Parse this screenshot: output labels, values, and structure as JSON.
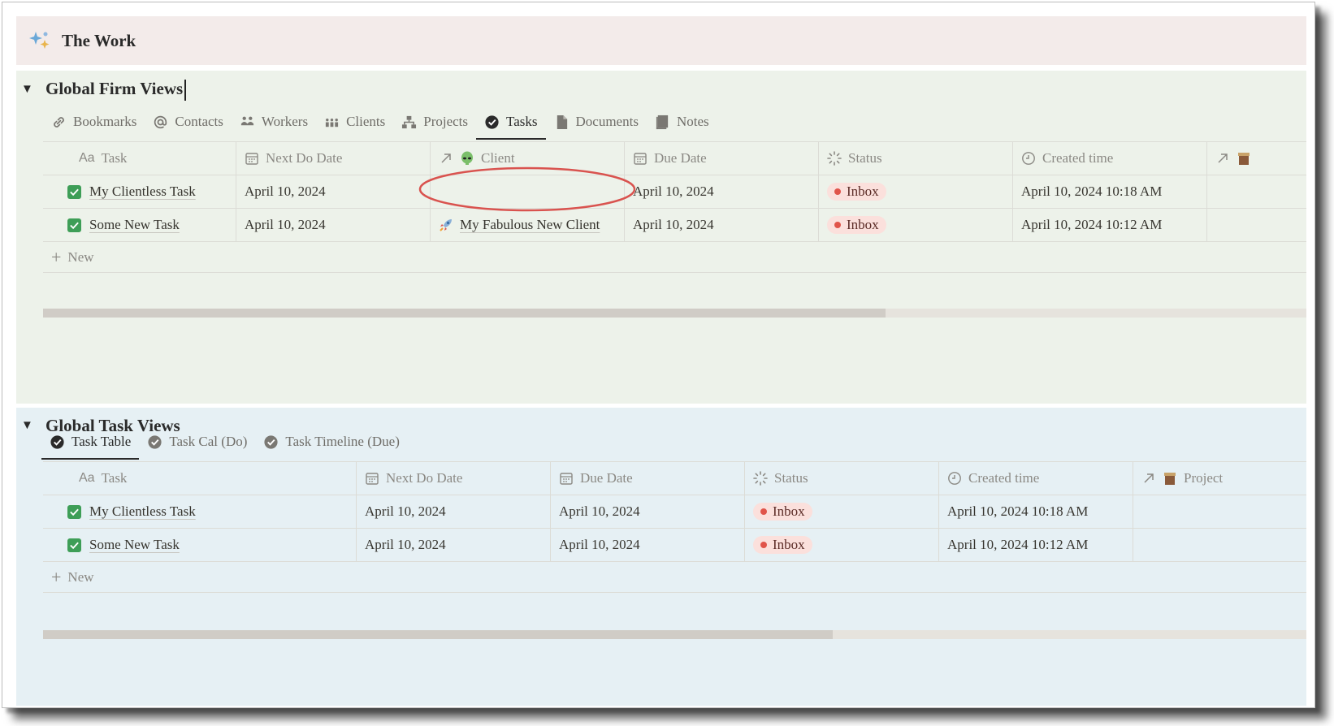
{
  "page": {
    "title": "The Work"
  },
  "firm_section": {
    "heading": "Global Firm Views",
    "tabs": [
      {
        "label": "Bookmarks",
        "icon": "link-icon",
        "active": false
      },
      {
        "label": "Contacts",
        "icon": "at-icon",
        "active": false
      },
      {
        "label": "Workers",
        "icon": "people-icon",
        "active": false
      },
      {
        "label": "Clients",
        "icon": "group-icon",
        "active": false
      },
      {
        "label": "Projects",
        "icon": "hierarchy-icon",
        "active": false
      },
      {
        "label": "Tasks",
        "icon": "check-circle-icon",
        "active": true
      },
      {
        "label": "Documents",
        "icon": "document-icon",
        "active": false
      },
      {
        "label": "Notes",
        "icon": "notebook-icon",
        "active": false
      }
    ],
    "columns": [
      "Task",
      "Next Do Date",
      "Client",
      "Due Date",
      "Status",
      "Created time"
    ],
    "title_prefix": "Aa",
    "rows": [
      {
        "task": "My Clientless Task",
        "next_do": "April 10, 2024",
        "client": "",
        "due": "April 10, 2024",
        "status": "Inbox",
        "created": "April 10, 2024 10:18 AM"
      },
      {
        "task": "Some New Task",
        "next_do": "April 10, 2024",
        "client": "My Fabulous New Client",
        "due": "April 10, 2024",
        "status": "Inbox",
        "created": "April 10, 2024 10:12 AM"
      }
    ],
    "new_label": "New",
    "scroll_fraction": 0.667
  },
  "task_section": {
    "heading": "Global Task Views",
    "tabs": [
      {
        "label": "Task Table",
        "active": true
      },
      {
        "label": "Task Cal (Do)",
        "active": false
      },
      {
        "label": "Task Timeline (Due)",
        "active": false
      }
    ],
    "columns": [
      "Task",
      "Next Do Date",
      "Due Date",
      "Status",
      "Created time",
      "Project"
    ],
    "title_prefix": "Aa",
    "rows": [
      {
        "task": "My Clientless Task",
        "next_do": "April 10, 2024",
        "due": "April 10, 2024",
        "status": "Inbox",
        "created": "April 10, 2024 10:18 AM"
      },
      {
        "task": "Some New Task",
        "next_do": "April 10, 2024",
        "due": "April 10, 2024",
        "status": "Inbox",
        "created": "April 10, 2024 10:12 AM"
      }
    ],
    "new_label": "New",
    "scroll_fraction": 0.625
  },
  "colors": {
    "top_bar": "#f3ebea",
    "firm_bg": "#edf2ea",
    "task_bg": "#e6f0f4",
    "status_pill": "#fbe0dc",
    "status_dot": "#e0544a",
    "checkbox": "#3e9e57",
    "annotation": "#d9534f"
  }
}
